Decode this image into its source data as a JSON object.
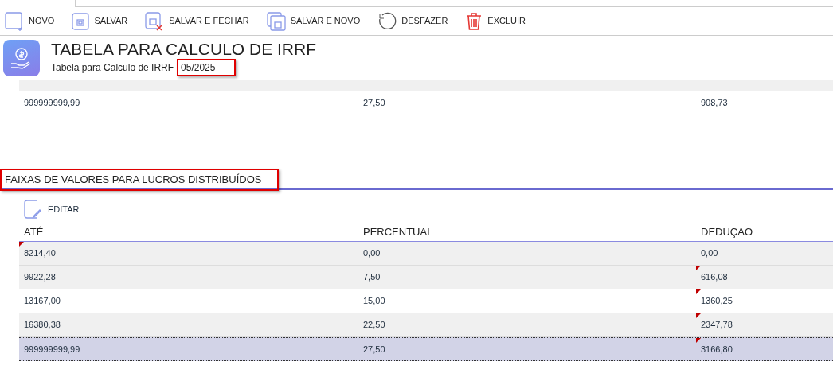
{
  "toolbar": [
    {
      "kind": "new",
      "label": "NOVO"
    },
    {
      "kind": "save",
      "label": "SALVAR"
    },
    {
      "kind": "save-close",
      "label": "SALVAR E FECHAR"
    },
    {
      "kind": "save-new",
      "label": "SALVAR E NOVO"
    },
    {
      "kind": "undo",
      "label": "DESFAZER"
    },
    {
      "kind": "delete",
      "label": "EXCLUIR"
    }
  ],
  "header": {
    "title": "TABELA PARA CALCULO DE IRRF",
    "subtitle": "Tabela para Calculo de IRRF",
    "period": "05/2025",
    "period_highlighted": true
  },
  "upper_table": {
    "rows": [
      {
        "cells": [
          {
            "text": "999999999,99",
            "edited": false
          },
          {
            "text": "27,50",
            "edited": false
          },
          {
            "text": "908,73",
            "edited": false
          }
        ]
      }
    ]
  },
  "section": {
    "title": "FAIXAS DE VALORES PARA LUCROS DISTRIBUÍDOS",
    "highlighted": true,
    "edit_button": "EDITAR",
    "columns": [
      "ATÉ",
      "PERCENTUAL",
      "DEDUÇÃO"
    ],
    "rows": [
      {
        "selected": false,
        "cells": [
          {
            "text": "8214,40",
            "edited": true
          },
          {
            "text": "0,00",
            "edited": false
          },
          {
            "text": "0,00",
            "edited": false
          }
        ]
      },
      {
        "selected": false,
        "cells": [
          {
            "text": "9922,28",
            "edited": false
          },
          {
            "text": "7,50",
            "edited": false
          },
          {
            "text": "616,08",
            "edited": true
          }
        ]
      },
      {
        "selected": false,
        "cells": [
          {
            "text": "13167,00",
            "edited": false
          },
          {
            "text": "15,00",
            "edited": false
          },
          {
            "text": "1360,25",
            "edited": true
          }
        ]
      },
      {
        "selected": false,
        "cells": [
          {
            "text": "16380,38",
            "edited": false
          },
          {
            "text": "22,50",
            "edited": false
          },
          {
            "text": "2347,78",
            "edited": true
          }
        ]
      },
      {
        "selected": true,
        "cells": [
          {
            "text": "999999999,99",
            "edited": false
          },
          {
            "text": "27,50",
            "edited": false
          },
          {
            "text": "3166,80",
            "edited": true
          }
        ]
      }
    ]
  }
}
